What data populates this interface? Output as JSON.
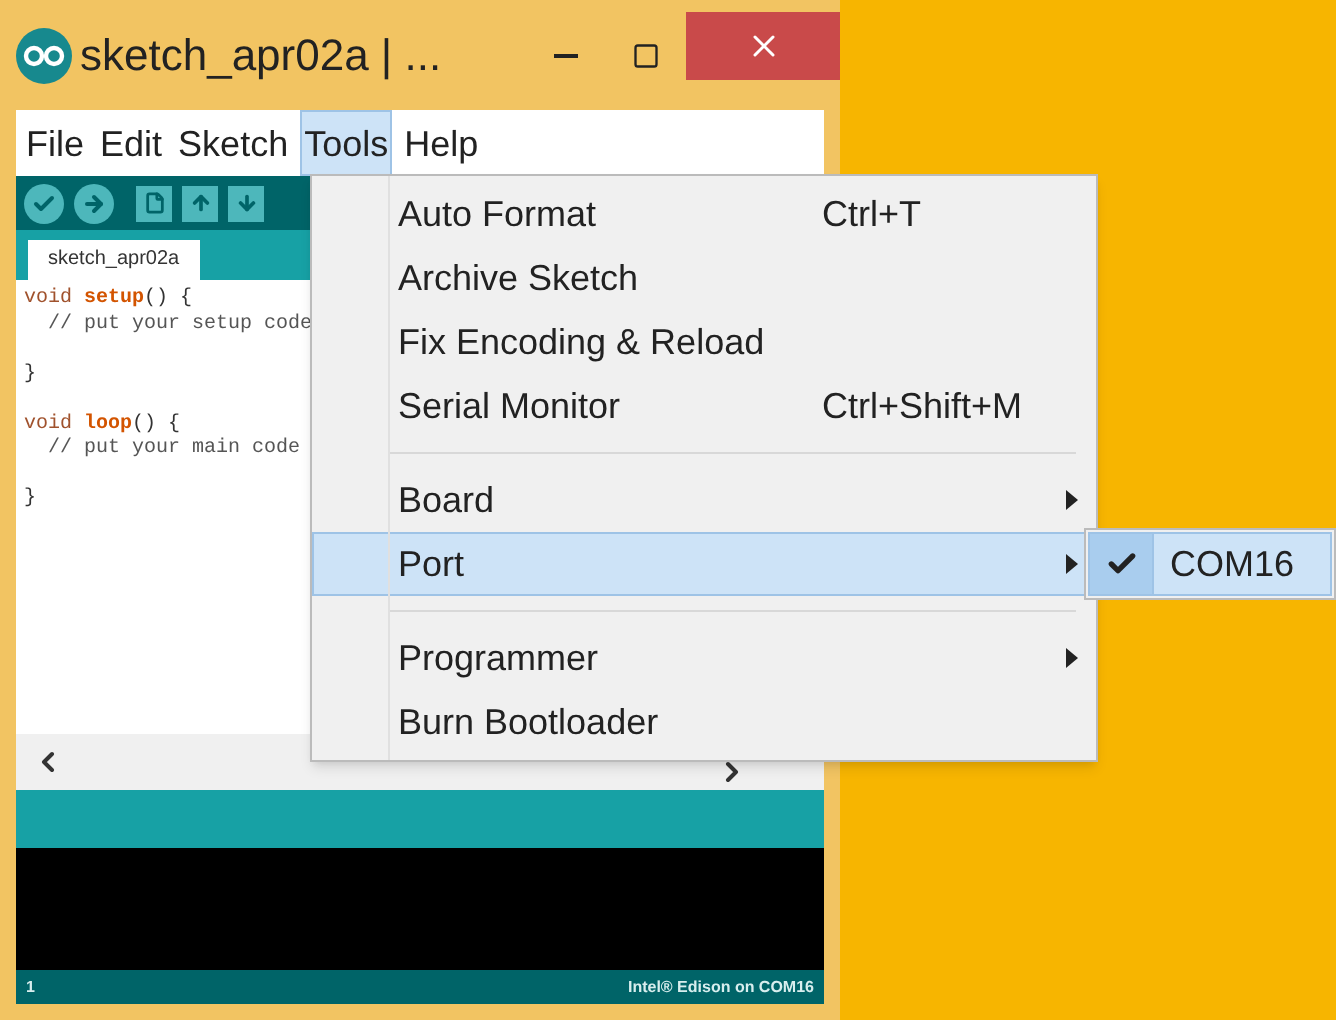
{
  "window": {
    "title": "sketch_apr02a | ..."
  },
  "menu_bar": [
    {
      "label": "File",
      "selected": false
    },
    {
      "label": "Edit",
      "selected": false
    },
    {
      "label": "Sketch",
      "selected": false
    },
    {
      "label": "Tools",
      "selected": true
    },
    {
      "label": "Help",
      "selected": false
    }
  ],
  "editor_tab": {
    "label": "sketch_apr02a"
  },
  "code_lines": [
    {
      "kind": "code",
      "tokens": [
        {
          "kind": "keyword",
          "text": "void"
        },
        {
          "kind": "function",
          "text": "setup"
        },
        {
          "kind": "plain",
          "text": "() {"
        }
      ]
    },
    {
      "kind": "code",
      "tokens": [
        {
          "kind": "comment",
          "text": "  // put your setup code"
        }
      ]
    },
    {
      "kind": "blank"
    },
    {
      "kind": "code",
      "tokens": [
        {
          "kind": "plain",
          "text": "}"
        }
      ]
    },
    {
      "kind": "blank"
    },
    {
      "kind": "code",
      "tokens": [
        {
          "kind": "keyword",
          "text": "void"
        },
        {
          "kind": "function",
          "text": "loop"
        },
        {
          "kind": "plain",
          "text": "() {"
        }
      ]
    },
    {
      "kind": "code",
      "tokens": [
        {
          "kind": "comment",
          "text": "  // put your main code"
        }
      ]
    },
    {
      "kind": "blank"
    },
    {
      "kind": "code",
      "tokens": [
        {
          "kind": "plain",
          "text": "}"
        }
      ]
    }
  ],
  "tools_menu": [
    {
      "kind": "item",
      "label": "Auto Format",
      "shortcut": "Ctrl+T",
      "selected": false
    },
    {
      "kind": "item",
      "label": "Archive Sketch",
      "selected": false
    },
    {
      "kind": "item",
      "label": "Fix Encoding & Reload",
      "selected": false
    },
    {
      "kind": "item",
      "label": "Serial Monitor",
      "shortcut": "Ctrl+Shift+M",
      "selected": false
    },
    {
      "kind": "separator"
    },
    {
      "kind": "submenu",
      "label": "Board",
      "selected": false
    },
    {
      "kind": "submenu",
      "label": "Port",
      "selected": true
    },
    {
      "kind": "separator"
    },
    {
      "kind": "submenu",
      "label": "Programmer",
      "selected": false
    },
    {
      "kind": "item",
      "label": "Burn Bootloader",
      "selected": false
    }
  ],
  "port_submenu": [
    {
      "label": "COM16",
      "checked": true
    }
  ],
  "status_bar": {
    "line": "1",
    "board": "Intel® Edison on COM16"
  }
}
